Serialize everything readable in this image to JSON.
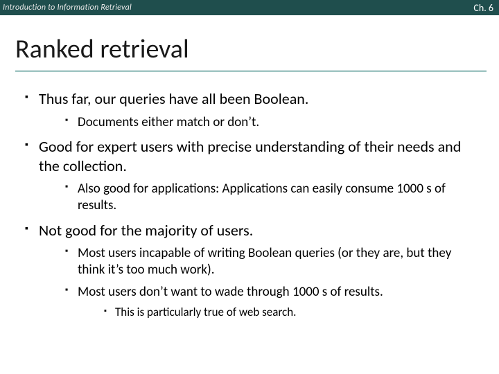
{
  "header": {
    "course": "Introduction to Information Retrieval",
    "chapter": "Ch. 6"
  },
  "title": "Ranked retrieval",
  "bullets": [
    {
      "text": "Thus far, our queries have all been Boolean.",
      "children": [
        {
          "text": "Documents either match or don’t."
        }
      ]
    },
    {
      "text": "Good for expert users with precise understanding of their needs and the collection.",
      "children": [
        {
          "text": "Also good for applications: Applications can easily consume 1000 s of results."
        }
      ]
    },
    {
      "text": "Not good for the majority of users.",
      "children": [
        {
          "text": "Most users incapable of writing Boolean queries (or they are, but they think it’s too much work)."
        },
        {
          "text": "Most users don’t want to wade through 1000 s of results.",
          "children": [
            {
              "text": "This is particularly true of web search."
            }
          ]
        }
      ]
    }
  ]
}
